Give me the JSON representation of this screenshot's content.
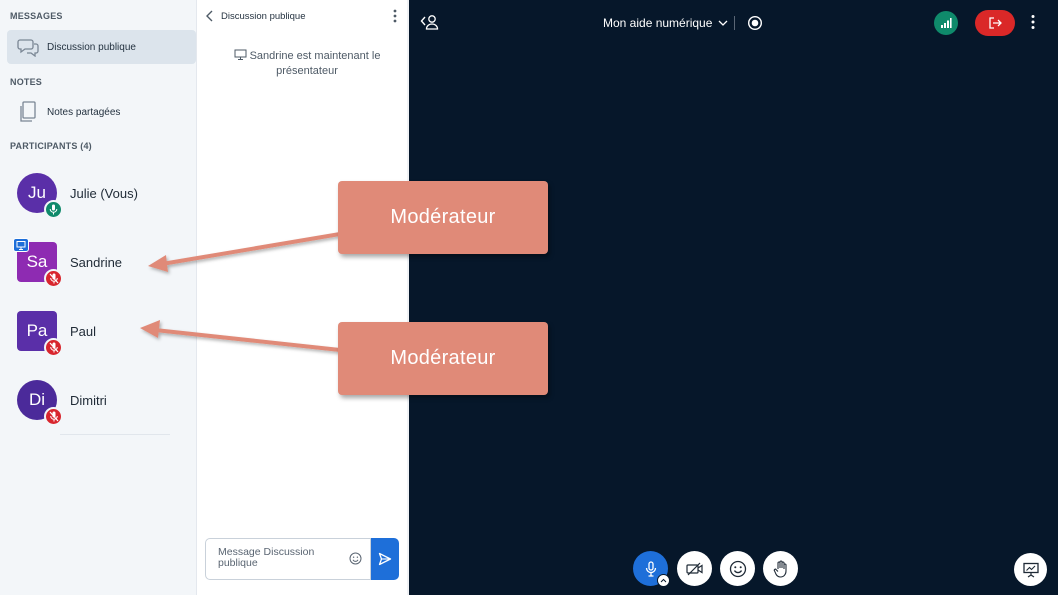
{
  "sidebar": {
    "messages_title": "MESSAGES",
    "public_chat_label": "Discussion publique",
    "notes_title": "NOTES",
    "shared_notes_label": "Notes partagées",
    "participants_title": "PARTICIPANTS (4)",
    "participants": [
      {
        "initials": "Ju",
        "name": "Julie (Vous)",
        "avatar_color": "#5A2FA8",
        "shape": "round",
        "mic": "on",
        "presenter": false
      },
      {
        "initials": "Sa",
        "name": "Sandrine",
        "avatar_color": "#8E2BB2",
        "shape": "square",
        "mic": "muted",
        "presenter": true
      },
      {
        "initials": "Pa",
        "name": "Paul",
        "avatar_color": "#5A2FA8",
        "shape": "square",
        "mic": "muted",
        "presenter": false
      },
      {
        "initials": "Di",
        "name": "Dimitri",
        "avatar_color": "#4B2A9A",
        "shape": "round",
        "mic": "muted",
        "presenter": false
      }
    ]
  },
  "chat": {
    "title": "Discussion publique",
    "system_message": "Sandrine est maintenant le présentateur",
    "input_placeholder": "Message Discussion publique"
  },
  "stage": {
    "meeting_title": "Mon aide numérique"
  },
  "callouts": [
    {
      "text": "Modérateur"
    },
    {
      "text": "Modérateur"
    }
  ],
  "colors": {
    "stage_bg": "#06172A",
    "accent_blue": "#1E6FD9",
    "leave_red": "#DA2828",
    "mic_on_green": "#0F8A6B",
    "mic_muted_red": "#D8262E",
    "callout": "#E08A78"
  }
}
